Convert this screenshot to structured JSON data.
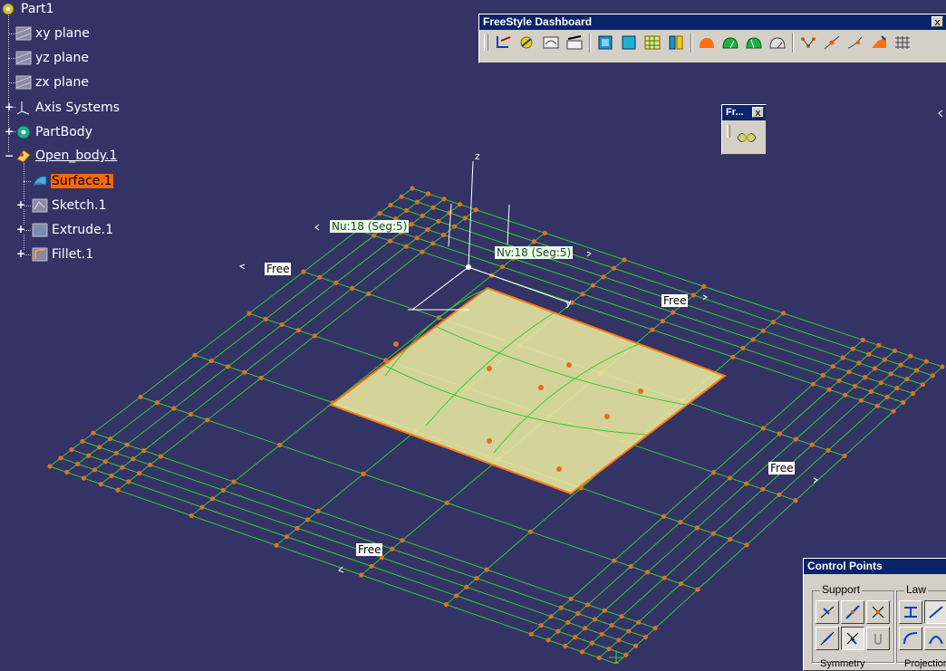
{
  "tree": {
    "root": "Part1",
    "items": [
      {
        "label": "xy plane"
      },
      {
        "label": "yz plane"
      },
      {
        "label": "zx plane"
      },
      {
        "label": "Axis Systems"
      },
      {
        "label": "PartBody"
      },
      {
        "label": "Open_body.1"
      },
      {
        "label": "Surface.1"
      },
      {
        "label": "Sketch.1"
      },
      {
        "label": "Extrude.1"
      },
      {
        "label": "Fillet.1"
      }
    ]
  },
  "dashboard": {
    "title": "FreeStyle Dashboard",
    "close": "x"
  },
  "mini_toolbar": {
    "title": "Fr...",
    "close": "x"
  },
  "control_points": {
    "title": "Control Points",
    "support_label": "Support",
    "law_label": "Law",
    "symmetry_label": "Symmetry",
    "projection_label": "Projection"
  },
  "viewport": {
    "nu_label": "Nu:18 (Seg:5)",
    "nv_label": "Nv:18 (Seg:5)",
    "axis_z": "z",
    "axis_y": "y",
    "free_labels": [
      "Free",
      "Free",
      "Free",
      "Free"
    ]
  },
  "colors": {
    "background": "#333366",
    "grid": "#33cc33",
    "control_point": "#e07020",
    "surface_fill": "#e6e6a0",
    "surface_edge": "#ff7711",
    "selection": "#ff6600",
    "title_bar": "#0a246a"
  }
}
